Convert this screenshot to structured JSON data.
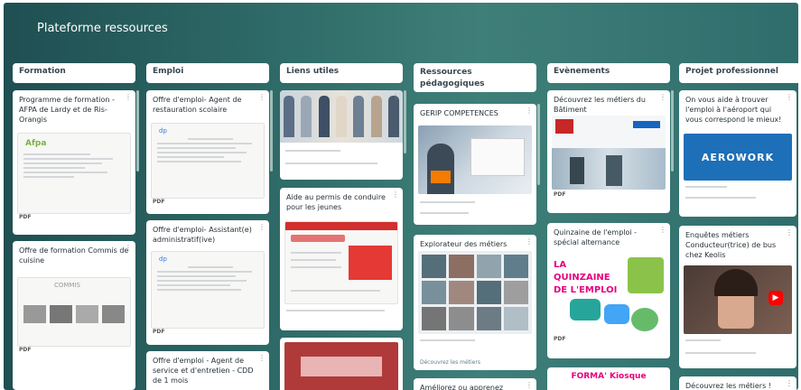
{
  "header": {
    "meta": "",
    "title": "Plateforme ressources",
    "subtitle": ""
  },
  "columns": [
    {
      "title": "Formation",
      "cards": [
        {
          "title": "Programme de formation - AFPA de Lardy et de Ris-Orangis",
          "pdf": "PDF"
        },
        {
          "title": "Offre de formation Commis de cuisine",
          "pdf": "PDF"
        }
      ]
    },
    {
      "title": "Emploi",
      "cards": [
        {
          "title": "Offre d'emploi- Agent de restauration scolaire",
          "pdf": "PDF"
        },
        {
          "title": "Offre d'emploi- Assistant(e) administratif(ive)",
          "pdf": "PDF"
        },
        {
          "title": "Offre d'emploi - Agent de service et d'entretien - CDD de 1 mois",
          "pdf": ""
        }
      ]
    },
    {
      "title": "Liens utiles",
      "cards": [
        {
          "title": "",
          "pdf": ""
        },
        {
          "title": "Aide au permis de conduire pour les jeunes",
          "pdf": ""
        },
        {
          "title": "",
          "pdf": ""
        }
      ]
    },
    {
      "title": "Ressources\npédagogiques",
      "cards": [
        {
          "title": "GERIP COMPETENCES",
          "pdf": ""
        },
        {
          "title": "Explorateur des métiers",
          "footer": "Découvrez les métiers"
        },
        {
          "title": "Améliorez ou apprenez",
          "pdf": ""
        }
      ]
    },
    {
      "title": "Evènements",
      "cards": [
        {
          "title": "Découvrez les métiers du Bâtiment",
          "pdf": "PDF"
        },
        {
          "title": "Quinzaine de l'emploi - spécial alternance",
          "poster": "LA QUINZAINE DE L'EMPLOI",
          "pdf": "PDF"
        },
        {
          "title": "",
          "poster": "FORMA' Kiosque"
        }
      ]
    },
    {
      "title": "Projet professionnel",
      "cards": [
        {
          "title": "On vous aide à trouver l'emploi à l'aéroport qui vous correspond le mieux!",
          "logo": "AEROWORK"
        },
        {
          "title": "Enquêtes métiers Conducteur(trice) de bus chez Keolis",
          "pdf": ""
        },
        {
          "title": "Découvrez les métiers !",
          "pdf": ""
        }
      ]
    }
  ],
  "colors": {
    "board_dark": "#1f4f52",
    "board_mid": "#3f7f79",
    "poster_pink": "#e6007e",
    "aero_blue": "#1d6fb8"
  }
}
